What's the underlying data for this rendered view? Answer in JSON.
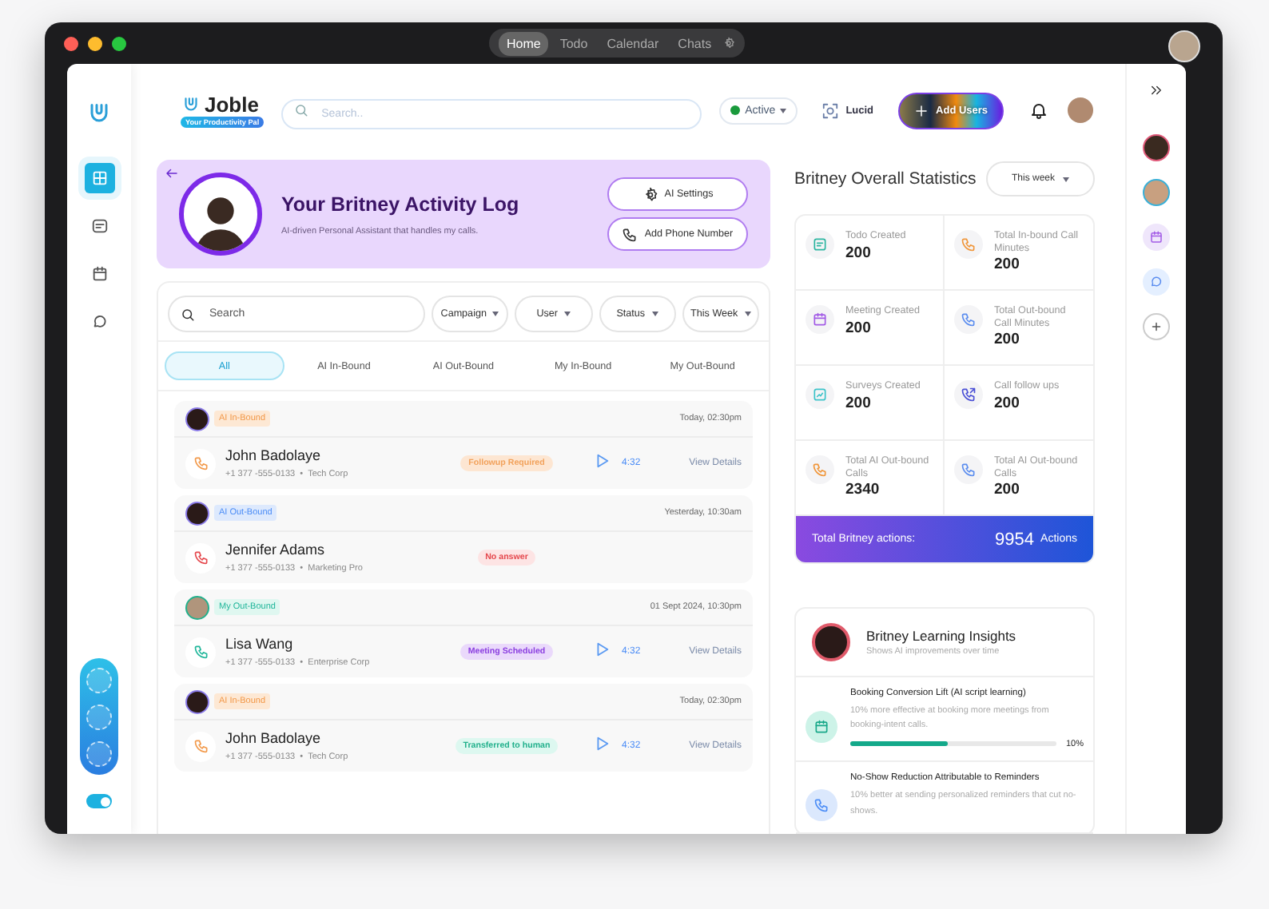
{
  "window": {
    "nav": [
      {
        "label": "Home",
        "selected": true
      },
      {
        "label": "Todo",
        "selected": false
      },
      {
        "label": "Calendar",
        "selected": false
      },
      {
        "label": "Chats",
        "selected": false
      }
    ]
  },
  "sidebar": {
    "items": [
      {
        "kind": "grid",
        "selected": true
      },
      {
        "kind": "notes",
        "selected": false
      },
      {
        "kind": "calendar",
        "selected": false
      },
      {
        "kind": "chat",
        "selected": false
      }
    ],
    "toggle_on": true
  },
  "header": {
    "brand": "Joble",
    "tagline": "Your Productivity Pal",
    "search_placeholder": "Search..",
    "status": "Active",
    "workspace": "Lucid",
    "add_button": "Add Users"
  },
  "banner": {
    "title": "Your Britney Activity Log",
    "subtitle": "AI-driven Personal Assistant that handles my calls.",
    "buttons": [
      {
        "label": "AI Settings",
        "kind": "settings"
      },
      {
        "label": "Add Phone Number",
        "kind": "phone"
      }
    ]
  },
  "filters": {
    "search_placeholder": "Search",
    "dropdowns": [
      "Campaign",
      "User",
      "Status",
      "This Week"
    ]
  },
  "tabs": [
    {
      "label": "All",
      "selected": true
    },
    {
      "label": "AI In-Bound",
      "selected": false
    },
    {
      "label": "AI Out-Bound",
      "selected": false
    },
    {
      "label": "My In-Bound",
      "selected": false
    },
    {
      "label": "My Out-Bound",
      "selected": false
    }
  ],
  "calls": [
    {
      "type": "AI In-Bound",
      "kind": "ai_inbound",
      "time": "Today, 02:30pm",
      "name": "John Badolaye",
      "phone": "+1 377 -555-0133",
      "company": "Tech Corp",
      "separator": "•",
      "call_icon": {
        "kind": "inbound"
      },
      "status": {
        "label": "Followup Required",
        "kind": "followup"
      },
      "duration": "4:32",
      "action": "View Details"
    },
    {
      "type": "AI Out-Bound",
      "kind": "ai_outbound",
      "time": "Yesterday, 10:30am",
      "name": "Jennifer Adams",
      "phone": "+1 377 -555-0133",
      "company": "Marketing Pro",
      "separator": "•",
      "call_icon": {
        "kind": "missed"
      },
      "status": {
        "label": "No answer",
        "kind": "no_answer"
      }
    },
    {
      "type": "My Out-Bound",
      "kind": "my_outbound",
      "time": "01 Sept 2024, 10:30pm",
      "name": "Lisa Wang",
      "phone": "+1 377 -555-0133",
      "company": "Enterprise Corp",
      "separator": "•",
      "call_icon": {
        "kind": "outbound"
      },
      "status": {
        "label": "Meeting Scheduled",
        "kind": "meeting"
      },
      "duration": "4:32",
      "action": "View Details"
    },
    {
      "type": "AI In-Bound",
      "kind": "ai_inbound",
      "time": "Today, 02:30pm",
      "name": "John Badolaye",
      "phone": "+1 377 -555-0133",
      "company": "Tech Corp",
      "separator": "•",
      "call_icon": {
        "kind": "inbound"
      },
      "status": {
        "label": "Transferred to human",
        "kind": "transferred"
      },
      "duration": "4:32",
      "action": "View Details"
    }
  ],
  "stats": {
    "title": "Britney Overall Statistics",
    "period": "This week",
    "items": [
      {
        "label": "Todo Created",
        "value": "200",
        "kind": "todo",
        "color": "#2bb5a0"
      },
      {
        "label": "Total In-bound Call Minutes",
        "value": "200",
        "kind": "phone",
        "color": "#f0963a"
      },
      {
        "label": "Meeting Created",
        "value": "200",
        "kind": "calendar",
        "color": "#a35ce6"
      },
      {
        "label": "Total Out-bound Call Minutes",
        "value": "200",
        "kind": "phone",
        "color": "#5b8def"
      },
      {
        "label": "Surveys Created",
        "value": "200",
        "kind": "survey",
        "color": "#3cc3c9"
      },
      {
        "label": "Call follow ups",
        "value": "200",
        "kind": "followup",
        "color": "#4a4fd6"
      },
      {
        "label": "Total AI Out-bound Calls",
        "value": "2340",
        "kind": "phone",
        "color": "#f0963a"
      },
      {
        "label": "Total AI Out-bound Calls",
        "value": "200",
        "kind": "phone",
        "color": "#5b8def"
      }
    ],
    "total_label": "Total Britney actions:",
    "total_value": "9954",
    "total_unit": "Actions"
  },
  "insights": {
    "title": "Britney Learning Insights",
    "subtitle": "Shows AI improvements over time",
    "items": [
      {
        "kind": "calendar",
        "title": "Booking Conversion Lift (AI script learning)",
        "description": "10% more effective at booking more meetings from booking-intent calls.",
        "level": 0.47,
        "reading": "10%"
      },
      {
        "kind": "phone",
        "title": "No-Show Reduction Attributable to Reminders",
        "description": "10% better at sending personalized reminders that cut no-shows."
      }
    ]
  },
  "right_rail": {
    "items": [
      {
        "kind": "avatar"
      },
      {
        "kind": "avatar"
      },
      {
        "kind": "calendar"
      },
      {
        "kind": "chat"
      },
      {
        "kind": "add"
      }
    ]
  }
}
